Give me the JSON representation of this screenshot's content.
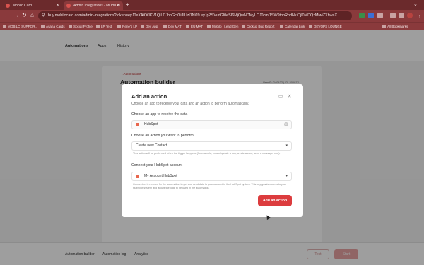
{
  "browser": {
    "tabs": [
      {
        "title": "Mobilo Card"
      },
      {
        "title": "Admin Integrations - MOBILO"
      }
    ],
    "url": "buy.mobilocard.com/admin-integrations?token=eyJ0eXAiOiJKV1QiLCJhbGciOiJIUzI1NiJ9.eyJpZSVudGl0eSI6MjQwNDMyLCJ0cml1SW9tbnRpdHkiOjI0MDQzMiwiZXhwaX...",
    "bookmarks": [
      "MOBILO SUPPOR...",
      "Asana Cards",
      "Social Profile",
      "LP Test",
      "Rene's LP",
      "Dev App",
      "Dev MAT",
      "EU MAT",
      "Mobilo | Lead Gen",
      "Clickup Bug Report",
      "Calendar Link",
      "DEVOPS LOUNGE",
      "All Bookmarks"
    ]
  },
  "app": {
    "nav": [
      "Automations",
      "Apps",
      "History"
    ],
    "breadcrumb": "‹  Automations",
    "title": "Automation builder",
    "user_id": "UserID: 240432 | ID: 201972",
    "bottom_tabs": [
      "Automation builder",
      "Automation log",
      "Analytics"
    ],
    "test_label": "Test",
    "start_label": "Start"
  },
  "modal": {
    "title": "Add an action",
    "subtitle": "Choose an app to receive your data and an action to perform automatically.",
    "app_label": "Choose an app to receive the data",
    "app_value": "HubSpot",
    "action_label": "Choose an action you want to perform",
    "action_value": "Create new Contact",
    "action_hint": "This action will be performed when the trigger happens (for example, create/update a row, create a card, send a message, etc.).",
    "connect_label": "Connect your HubSpot account",
    "account_value": "My Account HubSpot",
    "connect_hint": "Connection is needed for the automation to get and send data to your account in the HubSpot system. This key grants access to your HubSpot system and allows the data to be used in the automation.",
    "button_label": "Add an action"
  },
  "colors": {
    "accent": "#dc3c3e",
    "browser": "#8a3a3c"
  }
}
